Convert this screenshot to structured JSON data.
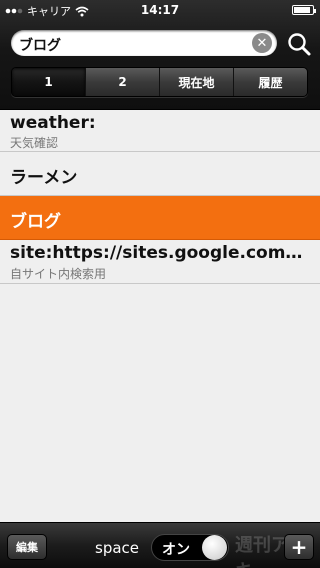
{
  "status_bar": {
    "carrier": "キャリア",
    "time": "14:17",
    "battery_level": 0.9
  },
  "search": {
    "value": "ブログ",
    "clear_icon": "⊗"
  },
  "segments": {
    "items": [
      "1",
      "2",
      "現在地",
      "履歴"
    ],
    "selected_index": 0
  },
  "list": [
    {
      "title": "weather:",
      "subtitle": "天気確認"
    },
    {
      "title": "ラーメン",
      "subtitle": ""
    },
    {
      "title": "ブログ",
      "subtitle": ""
    },
    {
      "title": "site:https://sites.google.com/sit...",
      "subtitle": "自サイト内検索用"
    }
  ],
  "toolbar": {
    "edit_label": "編集",
    "space_label": "space",
    "toggle_label": "オン",
    "add_label": "+",
    "watermark": "週刊アスキー"
  },
  "colors": {
    "selected_row": "#f36f10"
  }
}
